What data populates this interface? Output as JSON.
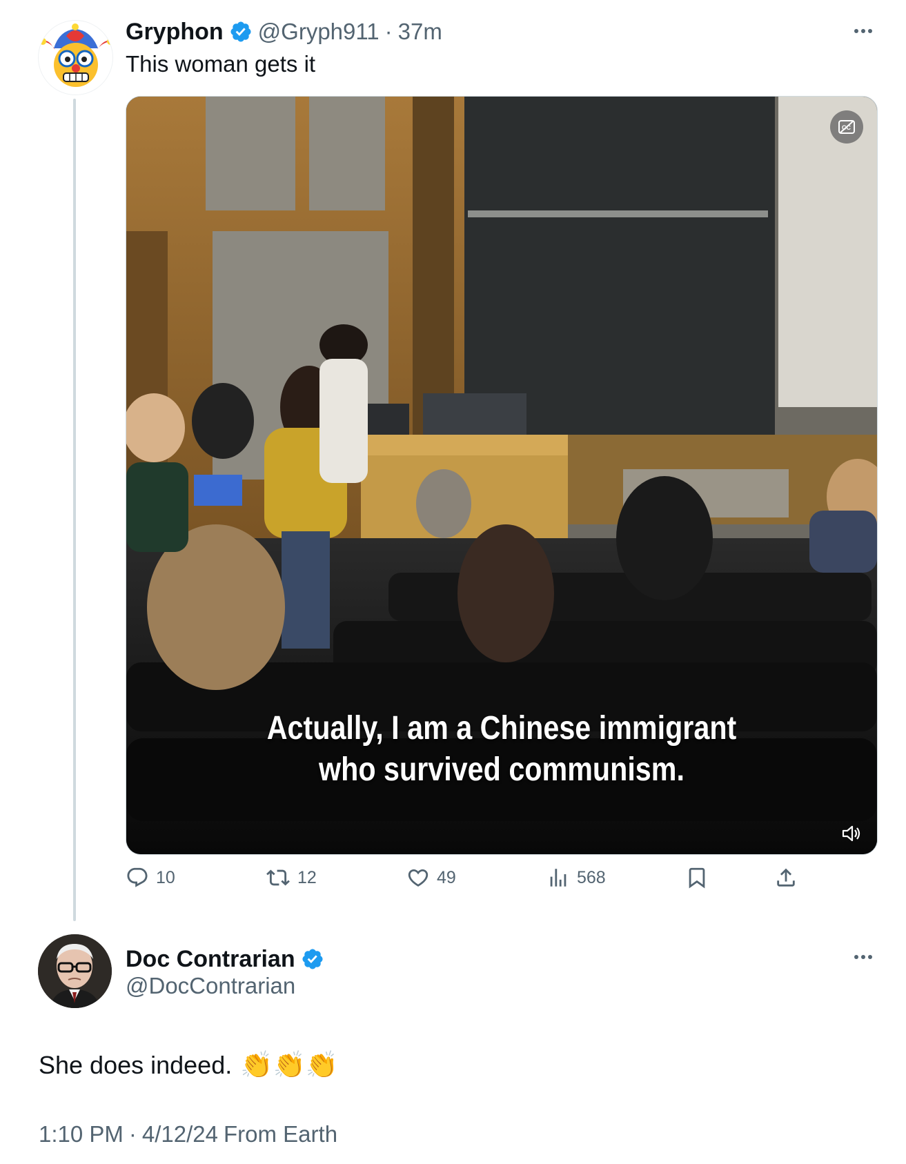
{
  "tweet": {
    "author_name": "Gryphon",
    "author_handle": "@Gryph911",
    "separator": "·",
    "time_ago": "37m",
    "text": "This woman gets it",
    "video": {
      "caption_line1": "Actually, I am a Chinese immigrant",
      "caption_line2": "who survived communism."
    },
    "stats": {
      "replies": "10",
      "retweets": "12",
      "likes": "49",
      "views": "568"
    },
    "icons": [
      "reply-icon",
      "retweet-icon",
      "like-icon",
      "views-icon",
      "bookmark-icon",
      "share-icon",
      "verified-icon",
      "more-icon",
      "captions-icon",
      "volume-icon"
    ]
  },
  "reply": {
    "author_name": "Doc Contrarian",
    "author_handle": "@DocContrarian",
    "text": "She does indeed.",
    "emoji": "👏👏👏",
    "timestamp": "1:10 PM",
    "separator": "·",
    "date": "4/12/24",
    "source": "From Earth"
  },
  "colors": {
    "verified": "#1d9bf0",
    "muted_text": "#536471",
    "primary_text": "#0f1419",
    "thread_line": "#cfd9de"
  }
}
